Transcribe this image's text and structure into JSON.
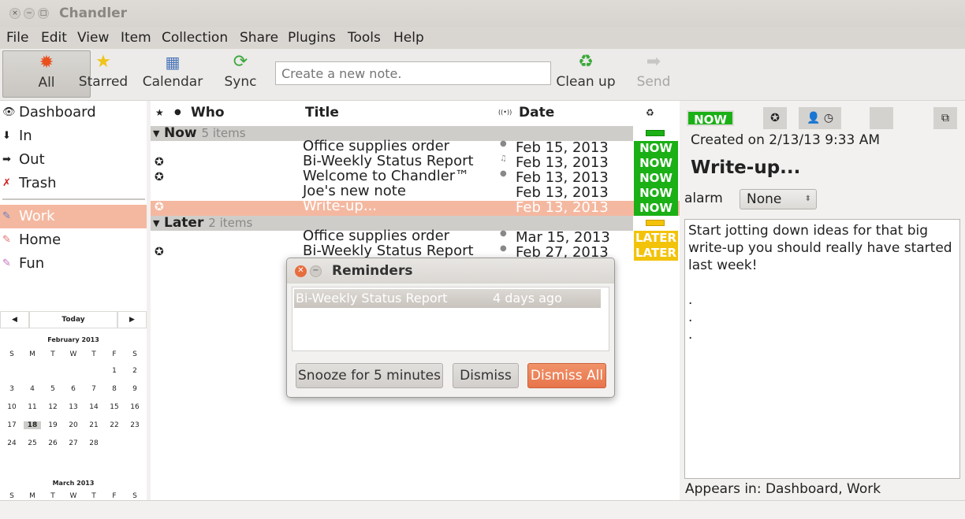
{
  "window": {
    "title": "Chandler",
    "close": "×",
    "minimize": "−",
    "maximize": "□"
  },
  "menu": [
    "File",
    "Edit",
    "View",
    "Item",
    "Collection",
    "Share",
    "Plugins",
    "Tools",
    "Help"
  ],
  "toolbar": {
    "all": "All",
    "starred": "Starred",
    "calendar": "Calendar",
    "sync": "Sync",
    "note_placeholder": "Create a new note.",
    "cleanup": "Clean up",
    "send": "Send"
  },
  "sidebar": {
    "top": [
      {
        "label": "Dashboard",
        "icon": "👁"
      },
      {
        "label": "In",
        "icon": "⬇"
      },
      {
        "label": "Out",
        "icon": "➡"
      },
      {
        "label": "Trash",
        "icon": "✗"
      }
    ],
    "collections": [
      {
        "label": "Work",
        "icon": "✎",
        "color": "#6a7dc0"
      },
      {
        "label": "Home",
        "icon": "✎",
        "color": "#e07070"
      },
      {
        "label": "Fun",
        "icon": "✎",
        "color": "#c070c0"
      }
    ]
  },
  "calendar": {
    "prev": "◀",
    "next": "▶",
    "today": "Today",
    "month1": "February 2013",
    "month2": "March 2013",
    "weekdays": [
      "S",
      "M",
      "T",
      "W",
      "T",
      "F",
      "S"
    ],
    "weeks": [
      [
        "",
        "",
        "",
        "",
        "",
        "1",
        "2"
      ],
      [
        "3",
        "4",
        "5",
        "6",
        "7",
        "8",
        "9"
      ],
      [
        "10",
        "11",
        "12",
        "13",
        "14",
        "15",
        "16"
      ],
      [
        "17",
        "18",
        "19",
        "20",
        "21",
        "22",
        "23"
      ],
      [
        "24",
        "25",
        "26",
        "27",
        "28",
        "",
        ""
      ]
    ],
    "selected_day": "18"
  },
  "table": {
    "headers": {
      "star": "★",
      "dot": "●",
      "who": "Who",
      "title": "Title",
      "reminder": "((•))",
      "date": "Date",
      "triage": "♻"
    },
    "groups": {
      "now": {
        "label": "Now",
        "count": "5 items"
      },
      "later": {
        "label": "Later",
        "count": "2 items"
      }
    },
    "now_rows": [
      {
        "title": "Office supplies order",
        "date": "Feb 15, 2013",
        "triage": "NOW",
        "star": "",
        "rem": "●"
      },
      {
        "title": "Bi-Weekly Status Report",
        "date": "Feb 13, 2013",
        "triage": "NOW",
        "star": "✪",
        "rem": "♫"
      },
      {
        "title": "Welcome to Chandler™",
        "date": "Feb 13, 2013",
        "triage": "NOW",
        "star": "✪",
        "rem": "●"
      },
      {
        "title": "Joe's new note",
        "date": "Feb 13, 2013",
        "triage": "NOW",
        "star": "",
        "rem": ""
      },
      {
        "title": "Write-up...",
        "date": "Feb 13, 2013",
        "triage": "NOW",
        "star": "✪",
        "rem": ""
      }
    ],
    "later_rows": [
      {
        "title": "Office supplies order",
        "date": "Mar 15, 2013",
        "triage": "LATER",
        "star": "",
        "rem": "●"
      },
      {
        "title": "Bi-Weekly Status Report",
        "date": "Feb 27, 2013",
        "triage": "LATER",
        "star": "✪",
        "rem": "●"
      }
    ]
  },
  "detail": {
    "triage": "NOW",
    "created": "Created on 2/13/13 9:33 AM",
    "title": "Write-up...",
    "alarm_label": "alarm",
    "alarm_value": "None",
    "body": "Start jotting down ideas for that big write-up you should really have started last week!\n\n.\n.\n.",
    "appears_in": "Appears in: Dashboard, Work"
  },
  "reminders": {
    "title": "Reminders",
    "item": "Bi-Weekly Status Report",
    "ago": "4 days ago",
    "snooze": "Snooze for 5 minutes",
    "dismiss": "Dismiss",
    "dismiss_all": "Dismiss All"
  }
}
